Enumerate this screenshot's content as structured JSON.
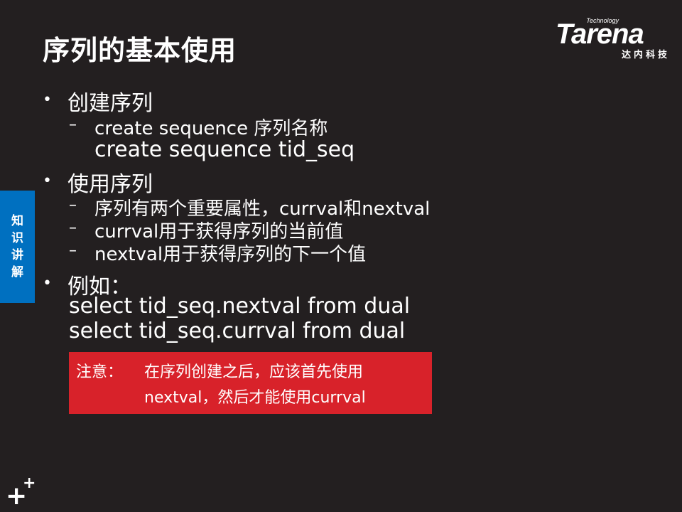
{
  "slide": {
    "title": "序列的基本使用",
    "logo": {
      "tech": "Technology",
      "word": "Tarena",
      "cn": "达内科技"
    },
    "side_tab": [
      "知",
      "识",
      "讲",
      "解"
    ],
    "bullets": [
      {
        "text": "创建序列"
      },
      {
        "dash": "–",
        "text": "create    sequence   序列名称"
      },
      {
        "text": "create sequence tid_seq"
      },
      {
        "text": "使用序列"
      },
      {
        "dash": "–",
        "text": "序列有两个重要属性，currval和nextval"
      },
      {
        "dash": "–",
        "text": "currval用于获得序列的当前值"
      },
      {
        "dash": "–",
        "text": "nextval用于获得序列的下一个值"
      },
      {
        "text": "例如："
      },
      {
        "text": "select tid_seq.nextval from dual"
      },
      {
        "text": "select tid_seq.currval from dual"
      }
    ],
    "bullet_mark": "•",
    "note": {
      "label": "注意：",
      "line1": "在序列创建之后，应该首先使用",
      "line2": "nextval，然后才能使用currval"
    },
    "corner_big": "+",
    "corner_small": "+"
  }
}
